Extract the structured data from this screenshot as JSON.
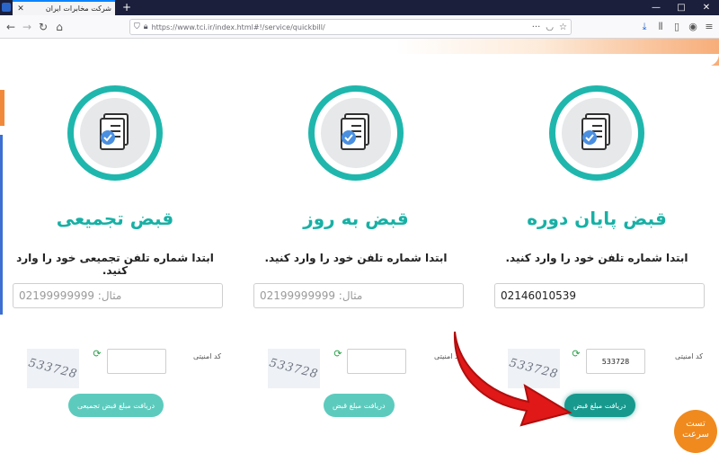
{
  "browser": {
    "tab_title": "شرکت مخابرات ایران",
    "tab_close": "✕",
    "new_tab": "+",
    "url": "https://www.tci.ir/index.html#!/service/quickbill/",
    "win_minimize": "—",
    "win_maximize": "□",
    "win_close": "✕"
  },
  "cards": [
    {
      "title": "قبض پایان دوره",
      "desc": "ابتدا شماره تلفن خود را وارد کنید.",
      "phone_value": "02146010539",
      "phone_placeholder": "",
      "captcha_label": "کد امنیتی",
      "captcha_value": "533728",
      "captcha_text": "533728",
      "button": "دریافت مبلغ قبض"
    },
    {
      "title": "قبض به روز",
      "desc": "ابتدا شماره تلفن خود را وارد کنید.",
      "phone_value": "",
      "phone_placeholder": "مثال: 02199999999",
      "captcha_label": "کد امنیتی",
      "captcha_value": "",
      "captcha_text": "533728",
      "button": "دریافت مبلغ قبض"
    },
    {
      "title": "قبض تجمیعی",
      "desc": "ابتدا شماره تلفن تجمیعی خود را وارد کنید.",
      "phone_value": "",
      "phone_placeholder": "مثال: 02199999999",
      "captcha_label": "کد امنیتی",
      "captcha_value": "",
      "captcha_text": "533728",
      "button": "دریافت مبلغ قبض تجمیعی"
    }
  ],
  "fast_badge": {
    "line1": "تست",
    "line2": "سرعت"
  },
  "colors": {
    "accent": "#1fb7ad",
    "button": "#5ccbbe",
    "button_active": "#17998e",
    "arrow": "#e01818",
    "badge": "#f08a1e"
  }
}
